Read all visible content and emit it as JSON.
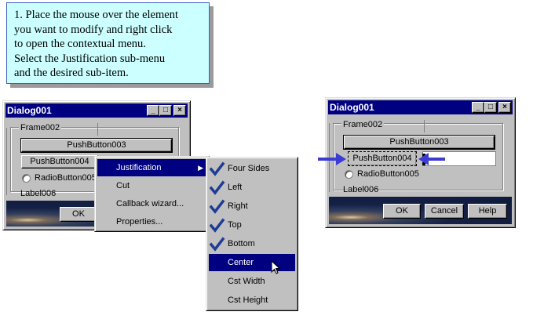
{
  "note": {
    "lines": [
      "1. Place the mouse over the element",
      "you want to modify and right click",
      "to open the contextual menu.",
      "Select the Justification sub-menu",
      "and the desired sub-item."
    ]
  },
  "left_dialog": {
    "title": "Dialog001",
    "frame_label": "Frame002",
    "push3": "PushButton003",
    "push4": "PushButton004",
    "radio": "RadioButton005",
    "label": "Label006",
    "ok": "OK"
  },
  "context_menu": {
    "items": [
      "Justification",
      "Cut",
      "Callback wizard...",
      "Properties..."
    ]
  },
  "submenu": {
    "items": [
      {
        "label": "Four Sides",
        "checked": true
      },
      {
        "label": "Left",
        "checked": true
      },
      {
        "label": "Right",
        "checked": true
      },
      {
        "label": "Top",
        "checked": true
      },
      {
        "label": "Bottom",
        "checked": true
      },
      {
        "label": "Center",
        "checked": false
      },
      {
        "label": "Cst Width",
        "checked": false
      },
      {
        "label": "Cst Height",
        "checked": false
      }
    ],
    "highlighted": "Center"
  },
  "right_dialog": {
    "title": "Dialog001",
    "frame_label": "Frame002",
    "push3": "PushButton003",
    "push4": "PushButton004",
    "radio": "RadioButton005",
    "label": "Label006",
    "ok": "OK",
    "cancel": "Cancel",
    "help": "Help"
  },
  "colors": {
    "title_bar": "#000080",
    "highlight": "#000080",
    "check": "#1e3c96",
    "arrow": "#3c3cd2",
    "note_bg": "#ccffff"
  }
}
